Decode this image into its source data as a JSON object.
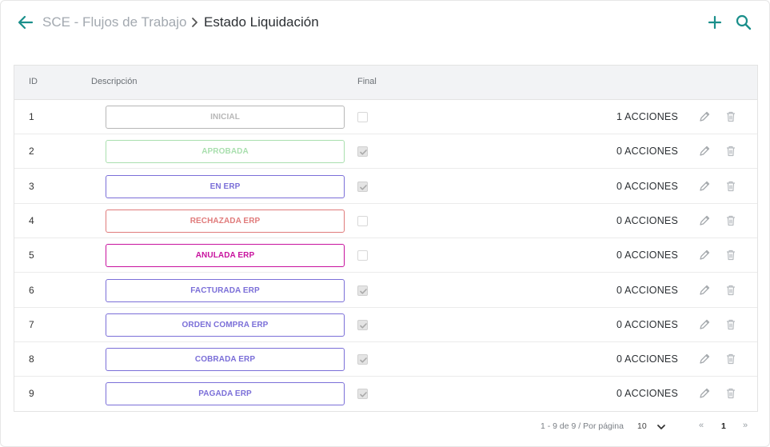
{
  "header": {
    "parent_label": "SCE - Flujos de Trabajo",
    "current_label": "Estado Liquidación",
    "icons": {
      "back": "arrow-left-icon",
      "separator": "chevron-right-icon",
      "add": "plus-icon",
      "search": "search-icon"
    },
    "accent_color": "#1a8f8b"
  },
  "table": {
    "columns": {
      "id": "ID",
      "description": "Descripción",
      "final": "Final"
    },
    "rows": [
      {
        "id": "1",
        "label": "INICIAL",
        "color": "#b7b7b7",
        "final": false,
        "acciones": "1 ACCIONES"
      },
      {
        "id": "2",
        "label": "APROBADA",
        "color": "#a9dfae",
        "final": true,
        "acciones": "0 ACCIONES"
      },
      {
        "id": "3",
        "label": "EN ERP",
        "color": "#7b6fd8",
        "final": true,
        "acciones": "0 ACCIONES"
      },
      {
        "id": "4",
        "label": "RECHAZADA ERP",
        "color": "#e07b7b",
        "final": false,
        "acciones": "0 ACCIONES"
      },
      {
        "id": "5",
        "label": "ANULADA ERP",
        "color": "#c8129e",
        "final": false,
        "acciones": "0 ACCIONES"
      },
      {
        "id": "6",
        "label": "FACTURADA ERP",
        "color": "#7b6fd8",
        "final": true,
        "acciones": "0 ACCIONES"
      },
      {
        "id": "7",
        "label": "ORDEN COMPRA ERP",
        "color": "#7b6fd8",
        "final": true,
        "acciones": "0 ACCIONES"
      },
      {
        "id": "8",
        "label": "COBRADA ERP",
        "color": "#7b6fd8",
        "final": true,
        "acciones": "0 ACCIONES"
      },
      {
        "id": "9",
        "label": "PAGADA ERP",
        "color": "#7b6fd8",
        "final": true,
        "acciones": "0 ACCIONES"
      }
    ],
    "row_icons": {
      "edit": "pencil-icon",
      "delete": "trash-icon"
    }
  },
  "pagination": {
    "info": "1 - 9 de 9 / Por página",
    "page_size": "10",
    "prev": "«",
    "current_page": "1",
    "next": "»"
  }
}
